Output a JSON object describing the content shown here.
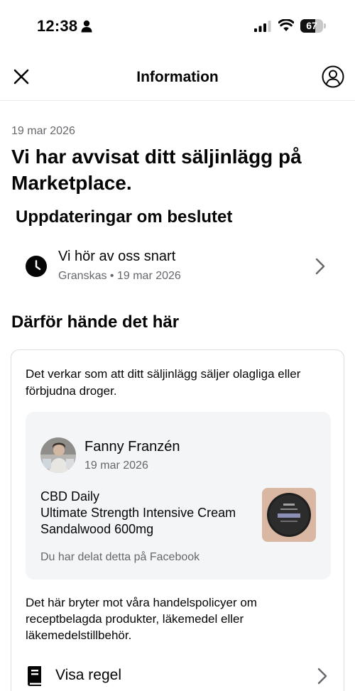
{
  "status_bar": {
    "time": "12:38",
    "battery_level": "67",
    "battery_fraction": 0.67,
    "icons": [
      "person-icon",
      "cellular-signal-icon",
      "wifi-icon",
      "battery-icon"
    ]
  },
  "header": {
    "title": "Information",
    "icons": [
      "close-icon",
      "profile-icon"
    ]
  },
  "notice": {
    "date": "19 mar 2026",
    "title": "Vi har avvisat ditt säljinlägg på Marketplace."
  },
  "updates": {
    "heading": "Uppdateringar om beslutet",
    "item": {
      "icon": "clock-icon",
      "title": "Vi hör av oss snart",
      "status": "Granskas",
      "separator": "•",
      "date": "19 mar 2026"
    }
  },
  "reason": {
    "heading": "Därför hände det här",
    "intro": "Det verkar som att ditt säljinlägg säljer olagliga eller förbjudna droger.",
    "post": {
      "author": "Fanny Franzén",
      "date": "19 mar 2026",
      "lines": [
        "CBD Daily",
        "Ultimate Strength Intensive Cream",
        "Sandalwood 600mg"
      ],
      "shared_note": "Du har delat detta på Facebook"
    },
    "policy_text": "Det här bryter mot våra handelspolicyer om receptbelagda produkter, läkemedel eller läkemedelstillbehör.",
    "rule_button": {
      "icon": "book-icon",
      "label": "Visa regel"
    }
  }
}
